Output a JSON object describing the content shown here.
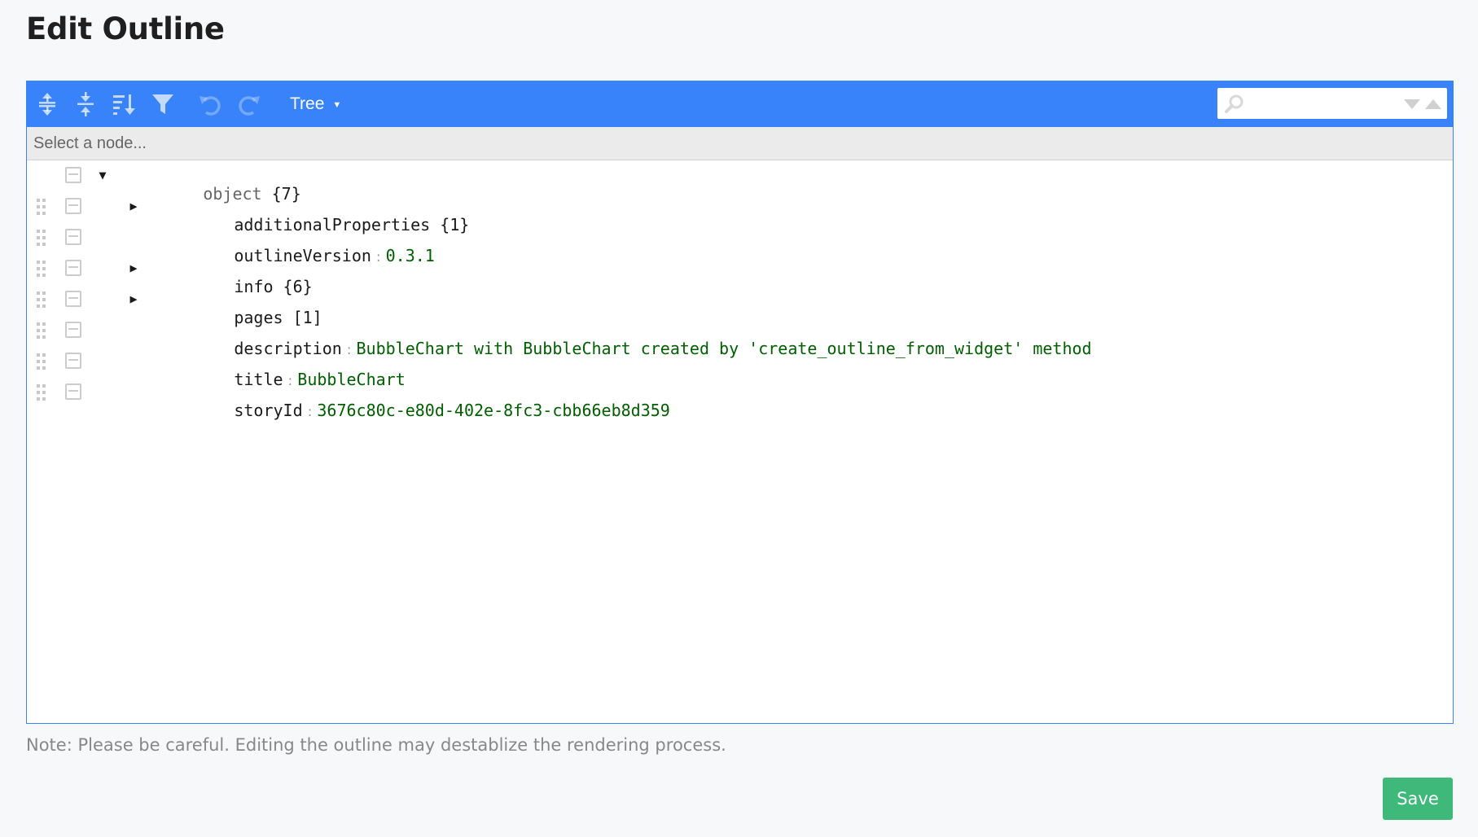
{
  "page": {
    "title": "Edit Outline"
  },
  "toolbar": {
    "mode_label": "Tree",
    "buttons": [
      "expand-all",
      "collapse-all",
      "sort",
      "filter",
      "undo",
      "redo"
    ],
    "search_placeholder": ""
  },
  "navbar": {
    "text": "Select a node..."
  },
  "tree": {
    "root": {
      "field": "object",
      "meta": "{7}"
    },
    "rows": [
      {
        "field": "additionalProperties",
        "meta": "{1}",
        "value": ""
      },
      {
        "field": "outlineVersion",
        "meta": "",
        "value": "0.3.1"
      },
      {
        "field": "info",
        "meta": "{6}",
        "value": ""
      },
      {
        "field": "pages",
        "meta": "[1]",
        "value": ""
      },
      {
        "field": "description",
        "meta": "",
        "value": "BubbleChart with BubbleChart created by 'create_outline_from_widget' method"
      },
      {
        "field": "title",
        "meta": "",
        "value": "BubbleChart"
      },
      {
        "field": "storyId",
        "meta": "",
        "value": "3676c80c-e80d-402e-8fc3-cbb66eb8d359"
      }
    ]
  },
  "note": "Note: Please be careful. Editing the outline may destablize the rendering process.",
  "actions": {
    "save_label": "Save"
  },
  "colors": {
    "accent": "#3883fa",
    "value": "#006000",
    "save": "#3eb97a"
  }
}
